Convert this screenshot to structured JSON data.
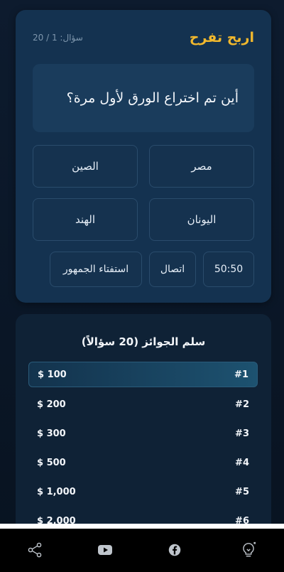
{
  "game": {
    "title": "اربح تفرح",
    "counter": "سؤال: 1 / 20"
  },
  "question": {
    "text": "أين تم اختراع الورق لأول مرة؟",
    "answers": [
      "مصر",
      "الصين",
      "اليونان",
      "الهند"
    ]
  },
  "lifelines": {
    "fifty": "50:50",
    "call": "اتصال",
    "audience": "استفتاء الجمهور"
  },
  "ladder": {
    "title": "سلم الجوائز (20 سؤالاً)",
    "rows": [
      {
        "level": "#1",
        "amount": "$ 100"
      },
      {
        "level": "#2",
        "amount": "$ 200"
      },
      {
        "level": "#3",
        "amount": "$ 300"
      },
      {
        "level": "#4",
        "amount": "$ 500"
      },
      {
        "level": "#5",
        "amount": "$ 1,000"
      },
      {
        "level": "#6",
        "amount": "$ 2,000"
      }
    ]
  },
  "bottom_bar": {
    "icons": [
      "share-icon",
      "youtube-icon",
      "facebook-icon",
      "lightbulb-icon"
    ]
  },
  "colors": {
    "accent": "#f1b82d",
    "card": "#143250",
    "background": "#0d1b2e"
  }
}
